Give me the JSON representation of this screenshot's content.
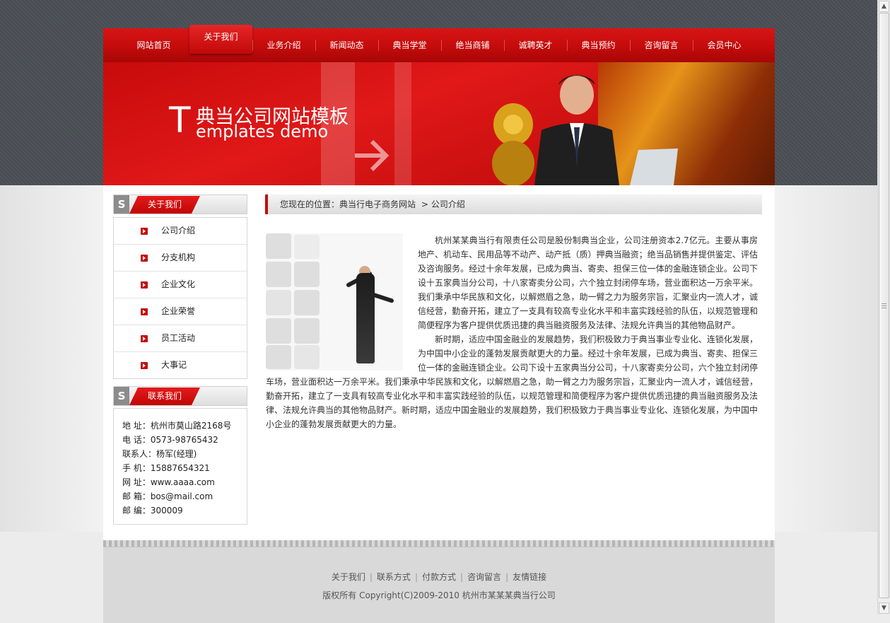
{
  "nav": {
    "items": [
      "网站首页",
      "关于我们",
      "业务介绍",
      "新闻动态",
      "典当学堂",
      "绝当商铺",
      "诚聘英才",
      "典当预约",
      "咨询留言",
      "会员中心"
    ],
    "active": "关于我们"
  },
  "banner": {
    "t_big": "T",
    "title_cn": "典当公司网站模板",
    "title_en": "emplates demo"
  },
  "sidebar": {
    "badge": "S",
    "about_title": "关于我们",
    "menu": [
      "公司介绍",
      "分支机构",
      "企业文化",
      "企业荣誉",
      "员工活动",
      "大事记"
    ],
    "contact_title": "联系我们",
    "contact": [
      "地  址：杭州市莫山路2168号",
      "电  话：0573-98765432",
      "联系人：杨军(经理)",
      "手  机：15887654321",
      "网  址：www.aaaa.com",
      "邮  箱：bos@mail.com",
      "邮  编：300009"
    ]
  },
  "breadcrumb": {
    "prefix": "您现在的位置：典当行电子商务网站",
    "sep": ">",
    "current": "公司介绍"
  },
  "article": {
    "p1": "杭州某某典当行有限责任公司是股份制典当企业，公司注册资本2.7亿元。主要从事房地产、机动车、民用品等不动产、动产抵（质）押典当融资；绝当品销售并提供鉴定、评估及咨询服务。经过十余年发展，已成为典当、寄卖、担保三位一体的金融连锁企业。公司下设十五家典当分公司，十八家寄卖分公司，六个独立封闭停车场，营业面积达一万余平米。我们秉承中华民族和文化，以解燃眉之急，助一臂之力为服务宗旨，汇聚业内一流人才，诚信经营，勤奋开拓，建立了一支具有较高专业化水平和丰富实践经验的队伍，以规范管理和简便程序为客户提供优质迅捷的典当融资服务及法律、法规允许典当的其他物品财产。",
    "p2": "新时期，适应中国金融业的发展趋势，我们积极致力于典当事业专业化、连锁化发展，为中国中小企业的蓬勃发展贡献更大的力量。经过十余年发展，已成为典当、寄卖、担保三位一体的金融连锁企业。公司下设十五家典当分公司，十八家寄卖分公司，六个独立封闭停车场，营业面积达一万余平米。我们秉承中华民族和文化，以解燃眉之急，助一臂之力为服务宗旨，汇聚业内一流人才，诚信经营，勤奋开拓，建立了一支具有较高专业化水平和丰富实践经验的队伍，以规范管理和简便程序为客户提供优质迅捷的典当融资服务及法律、法规允许典当的其他物品财产。新时期，适应中国金融业的发展趋势，我们积极致力于典当事业专业化、连锁化发展，为中国中小企业的蓬勃发展贡献更大的力量。"
  },
  "footer": {
    "links": [
      "关于我们",
      "联系方式",
      "付款方式",
      "咨询留言",
      "友情链接"
    ],
    "copyright": "版权所有  Copyright(C)2009-2010 杭州市某某某典当行公司"
  },
  "colors": {
    "brand_red": "#c40a0a",
    "dark_bg": "#4a4f55"
  }
}
